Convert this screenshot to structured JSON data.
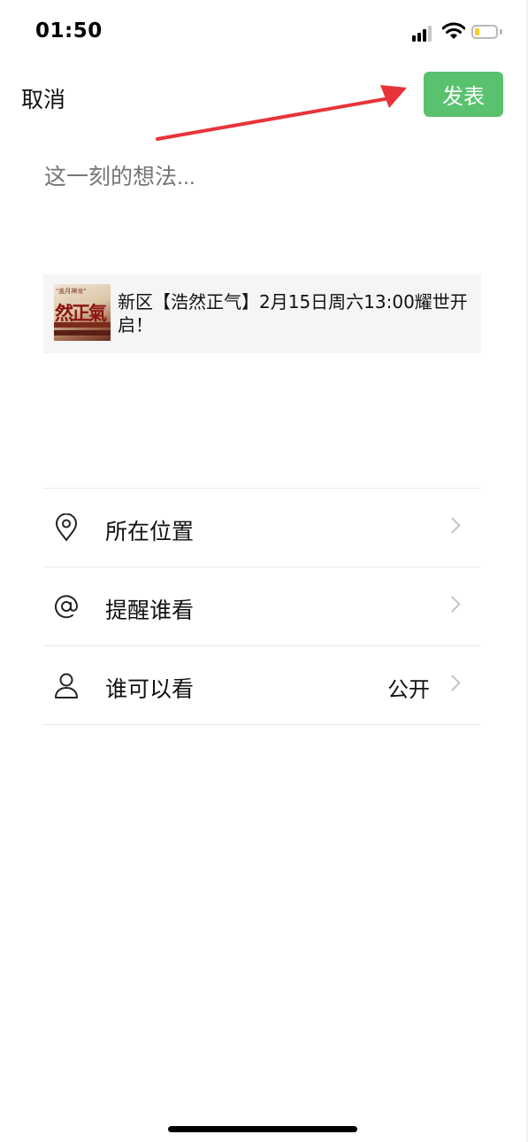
{
  "status_bar": {
    "time": "01:50",
    "icons": [
      "signal-icon",
      "wifi-icon",
      "battery-icon"
    ],
    "battery_color": "#f5cc2b"
  },
  "nav": {
    "cancel_label": "取消",
    "publish_label": "发表",
    "publish_color": "#5ac26f"
  },
  "composer": {
    "placeholder": "这一刻的想法..."
  },
  "share_card": {
    "title": "新区【浩然正气】2月15日周六13:00耀世开启！",
    "thumbnail_lines": [
      "\"盖月神龙\"",
      "然正氣"
    ]
  },
  "menu": [
    {
      "icon": "location-pin-icon",
      "label": "所在位置",
      "value": ""
    },
    {
      "icon": "at-sign-icon",
      "label": "提醒谁看",
      "value": ""
    },
    {
      "icon": "person-icon",
      "label": "谁可以看",
      "value": "公开"
    }
  ],
  "annotation": {
    "color": "#e8333a"
  }
}
